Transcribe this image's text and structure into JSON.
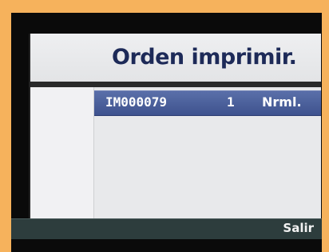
{
  "screen": {
    "title": "Orden imprimir."
  },
  "print_list": {
    "rows": [
      {
        "image": "IM000079",
        "copies": "1",
        "quality": "Nrml."
      }
    ]
  },
  "footer": {
    "exit_label": "Salir"
  },
  "colors": {
    "background": "#f6b25c",
    "title": "#1d2a58",
    "selection": "#4a5e9a",
    "footer": "#2d3d3d"
  }
}
